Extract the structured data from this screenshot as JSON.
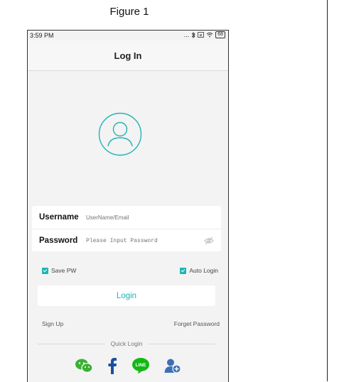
{
  "caption": "Figure 1",
  "status_bar": {
    "time": "3:59 PM",
    "dots": "...",
    "battery": "68"
  },
  "header": {
    "title": "Log In"
  },
  "form": {
    "username_label": "Username",
    "username_placeholder": "UserName/Email",
    "password_label": "Password",
    "password_placeholder": "Please Input Password"
  },
  "options": {
    "save_pw": "Save PW",
    "auto_login": "Auto Login"
  },
  "login_button": "Login",
  "links": {
    "sign_up": "Sign Up",
    "forget_password": "Forget Password"
  },
  "quick_login": {
    "label": "Quick Login",
    "line_badge": "LINE"
  },
  "colors": {
    "accent": "#22b3b3",
    "wechat": "#3cb034",
    "facebook": "#1a4fa0",
    "line": "#14b814",
    "contact": "#3d6fb6"
  }
}
